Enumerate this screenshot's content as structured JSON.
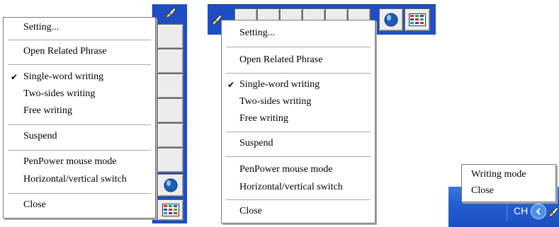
{
  "menu_left": {
    "items": [
      {
        "label": "Setting...",
        "checked": false
      },
      {
        "label": "Open Related Phrase",
        "checked": false
      },
      {
        "label": "Single-word writing",
        "checked": true
      },
      {
        "label": "Two-sides writing",
        "checked": false
      },
      {
        "label": "Free writing",
        "checked": false
      },
      {
        "label": "Suspend",
        "checked": false
      },
      {
        "label": "PenPower mouse mode",
        "checked": false
      },
      {
        "label": "Horizontal/vertical switch",
        "checked": false
      },
      {
        "label": "Close",
        "checked": false
      }
    ],
    "check_glyph": "✔"
  },
  "menu_middle": {
    "items": [
      {
        "label": "Setting...",
        "checked": false
      },
      {
        "label": "Open Related Phrase",
        "checked": false
      },
      {
        "label": "Single-word writing",
        "checked": true
      },
      {
        "label": "Two-sides writing",
        "checked": false
      },
      {
        "label": "Free writing",
        "checked": false
      },
      {
        "label": "Suspend",
        "checked": false
      },
      {
        "label": "PenPower mouse mode",
        "checked": false
      },
      {
        "label": "Horizontal/vertical switch",
        "checked": false
      },
      {
        "label": "Close",
        "checked": false
      }
    ],
    "check_glyph": "✔"
  },
  "menu_tray": {
    "items": [
      {
        "label": "Writing mode"
      },
      {
        "label": "Close"
      }
    ]
  },
  "taskbar": {
    "language_indicator": "CH"
  },
  "icons": {
    "pen": "pen-icon",
    "balloon": "balloon-icon",
    "keyboard": "keyboard-grid-icon",
    "tray_arrow": "chevron-left-icon"
  },
  "colors": {
    "toolbar_blue": "#1e4fc2",
    "cell_gray": "#ececec",
    "menu_bg": "#ffffff",
    "taskbar_blue": "#245fd0"
  }
}
